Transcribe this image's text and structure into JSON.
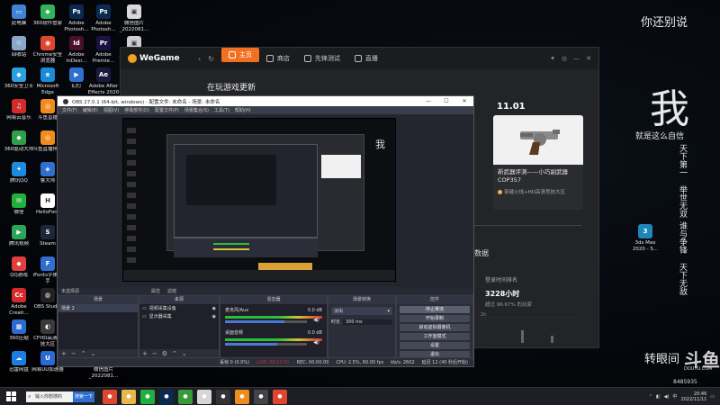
{
  "desktop": {
    "icons": [
      {
        "label": "此电脑",
        "color": "#3d84d6",
        "glyph": "▭"
      },
      {
        "label": "360软件管家",
        "color": "#2fb35c",
        "glyph": "◆"
      },
      {
        "label": "Adobe Photosh...",
        "color": "#0b2a52",
        "glyph": "Ps"
      },
      {
        "label": "Adobe Photosh...",
        "color": "#0b2a52",
        "glyph": "Ps"
      },
      {
        "label": "微信图片_2022081...",
        "color": "#d9d9d9",
        "glyph": "▣"
      },
      {
        "label": "回收站",
        "color": "#8aa6c8",
        "glyph": "♲"
      },
      {
        "label": "Chrome安全浏览器",
        "color": "#e0462f",
        "glyph": "◉"
      },
      {
        "label": "Adobe InDesi...",
        "color": "#4a0f2e",
        "glyph": "Id"
      },
      {
        "label": "Adobe Premie...",
        "color": "#1a1240",
        "glyph": "Pr"
      },
      {
        "label": "_2022081...",
        "color": "#cfcfcf",
        "glyph": "▣"
      },
      {
        "label": "360安全卫士",
        "color": "#2aa0e0",
        "glyph": "◆"
      },
      {
        "label": "Microsoft Edge",
        "color": "#1a8bd6",
        "glyph": "e"
      },
      {
        "label": "幻灯",
        "color": "#2f6fd0",
        "glyph": "▶"
      },
      {
        "label": "Adobe After Effects 2020",
        "color": "#1a1a3d",
        "glyph": "Ae"
      },
      {
        "label": "网易云音乐",
        "color": "#d22b2b",
        "glyph": "♫"
      },
      {
        "label": "斗鱼直播",
        "color": "#f08c1c",
        "glyph": "◎"
      },
      {
        "label": "360驱动大师",
        "color": "#2e9f4a",
        "glyph": "◆"
      },
      {
        "label": "斗鱼直播伴侣",
        "color": "#f08c1c",
        "glyph": "◎"
      },
      {
        "label": "腾讯QQ",
        "color": "#1d8ae0",
        "glyph": "✦"
      },
      {
        "label": "鲁大师",
        "color": "#2f6fd0",
        "glyph": "◈"
      },
      {
        "label": "微信",
        "color": "#20b040",
        "glyph": "✉"
      },
      {
        "label": "HelloFont",
        "color": "#ffffff",
        "glyph": "H"
      },
      {
        "label": "腾讯视频",
        "color": "#2aa55a",
        "glyph": "▶"
      },
      {
        "label": "Steam",
        "color": "#1b2838",
        "glyph": "S"
      },
      {
        "label": "QQ游戏",
        "color": "#e23e3e",
        "glyph": "◆"
      },
      {
        "label": "iFonts字体助手",
        "color": "#2f6fd0",
        "glyph": "F"
      },
      {
        "label": "Adobe Creati...",
        "color": "#d62b2b",
        "glyph": "Cc"
      },
      {
        "label": "OBS Studio",
        "color": "#222222",
        "glyph": "◍"
      },
      {
        "label": "360压缩",
        "color": "#2d6bd0",
        "glyph": "▦"
      },
      {
        "label": "CFHD高清竞技大区",
        "color": "#3a3a3a",
        "glyph": "◐"
      },
      {
        "label": "迅雷网盘",
        "color": "#1a7fe0",
        "glyph": "☁"
      },
      {
        "label": "网易UU加速器",
        "color": "#2a6ad6",
        "glyph": "U"
      },
      {
        "label": "微信图片_2022081...",
        "color": "#bbbbbb",
        "glyph": "▣"
      },
      {
        "label": "3ds Max 2020 - S...",
        "color": "#1e87b8",
        "glyph": "3"
      }
    ],
    "calligraphy": {
      "top": "你还别说",
      "big": "我",
      "line2": "就是这么自信",
      "col1": "天下第一",
      "col2": "举世无双",
      "col3": "谁与争锋",
      "col4": "天下无敌",
      "bottom": "转眼间"
    },
    "watermark": {
      "logo": "斗鱼",
      "site": "DOUYU.COM",
      "room_id": "8485935"
    }
  },
  "wegame": {
    "logo": "WeGame",
    "nav": [
      {
        "label": "主页",
        "icon": "home-icon",
        "active": true
      },
      {
        "label": "商店",
        "icon": "store-icon",
        "active": false
      },
      {
        "label": "先锋测试",
        "icon": "test-icon",
        "active": false
      },
      {
        "label": "直播",
        "icon": "live-icon",
        "active": false
      }
    ],
    "heading": "在玩游戏更新",
    "news_date": "11.01",
    "news_title": "新武器评测——小巧副武器COP357",
    "news_source": "穿越火线+HD高清竞技大区",
    "stats_title": "数据",
    "rank_label": "登录时间排名",
    "hours": "3228小时",
    "pct": "超过 96.67% 的玩家",
    "chart_label": "2h"
  },
  "obs": {
    "title": "OBS 27.0.1 (64-bit, windows) - 配置文件: 未命名 - 场景: 未命名",
    "menu": [
      "文件(F)",
      "编辑(E)",
      "视图(V)",
      "停靠部件(D)",
      "配置文件(P)",
      "场景集合(S)",
      "工具(T)",
      "帮助(H)"
    ],
    "preview_tabs": [
      "未选择源",
      "属性",
      "滤镜"
    ],
    "scenes": {
      "title": "场景",
      "items": [
        "场景 2"
      ]
    },
    "sources": {
      "title": "来源",
      "items": [
        "视频采集设备",
        "显示器采集"
      ]
    },
    "mixer": {
      "title": "混音器",
      "tracks": [
        {
          "name": "麦克风/Aux",
          "db": "0.0 dB",
          "level": 0.72
        },
        {
          "name": "桌面音频",
          "db": "0.0 dB",
          "level": 0.64
        }
      ]
    },
    "transitions": {
      "title": "场景转换",
      "type": "淡出",
      "duration_label": "时长",
      "duration": "300 ms"
    },
    "controls": {
      "title": "控件",
      "buttons": [
        "停止推流",
        "开始录制",
        "启动虚拟摄像机",
        "工作室模式",
        "设置",
        "退出"
      ]
    },
    "status": {
      "dropped": "丢帧 0 (0.0%)",
      "live": "LIVE: 00:12:51",
      "rec": "REC: 00:00:00",
      "cpu": "CPU: 2.5%, 60.00 fps",
      "kbps": "kb/s: 2602",
      "autoclip": "延迟 12 (40 秒后开始)"
    }
  },
  "taskbar": {
    "search_placeholder": "输入你想搜的",
    "search_button": "搜索一下",
    "apps": [
      {
        "name": "chrome-icon",
        "color": "#e0462f"
      },
      {
        "name": "folder-icon",
        "color": "#e6b84a"
      },
      {
        "name": "wechat-icon",
        "color": "#20b040"
      },
      {
        "name": "photoshop-icon",
        "color": "#0b2a52"
      },
      {
        "name": "app-icon",
        "color": "#3a9a3a"
      },
      {
        "name": "media-icon",
        "color": "#d6d6d6"
      },
      {
        "name": "obs-icon",
        "color": "#333333"
      },
      {
        "name": "wegame-icon",
        "color": "#f08c1c"
      },
      {
        "name": "game-icon",
        "color": "#444444"
      },
      {
        "name": "browser-icon",
        "color": "#e0462f"
      }
    ],
    "time": "20:46",
    "date": "2022/11/11"
  }
}
